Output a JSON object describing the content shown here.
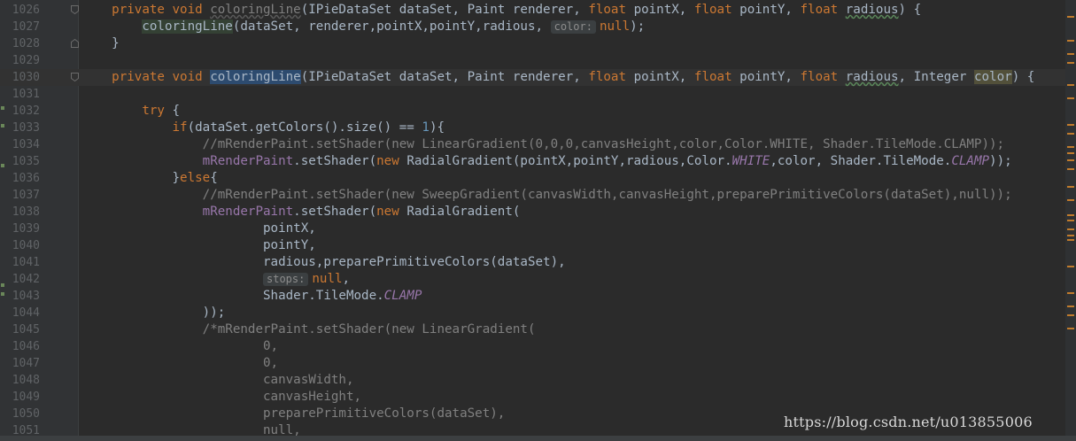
{
  "editor": {
    "watermark": "https://blog.csdn.net/u013855006",
    "lines": [
      {
        "num": "1026",
        "fold": "open",
        "segs": [
          [
            "    ",
            ""
          ],
          [
            "private void ",
            "kw"
          ],
          [
            "coloringLine",
            "unused"
          ],
          [
            "(IPieDataSet dataSet, Paint renderer, ",
            ""
          ],
          [
            "float ",
            "kw"
          ],
          [
            "pointX, ",
            ""
          ],
          [
            "float ",
            "kw"
          ],
          [
            "pointY, ",
            ""
          ],
          [
            "float ",
            "kw"
          ],
          [
            "radious",
            "typo"
          ],
          [
            ") {",
            ""
          ]
        ]
      },
      {
        "num": "1027",
        "segs": [
          [
            "        ",
            ""
          ],
          [
            "coloringLine",
            "hl"
          ],
          [
            "(dataSet, renderer,pointX,pointY,radious, ",
            ""
          ],
          [
            "color:",
            "hint"
          ],
          [
            "null",
            "kw"
          ],
          [
            ");",
            ""
          ]
        ]
      },
      {
        "num": "1028",
        "fold": "close",
        "segs": [
          [
            "    }",
            ""
          ]
        ]
      },
      {
        "num": "1029",
        "segs": []
      },
      {
        "num": "1030",
        "fold": "open",
        "current": true,
        "segs": [
          [
            "    ",
            ""
          ],
          [
            "private void ",
            "kw"
          ],
          [
            "coloringLine",
            "usage"
          ],
          [
            "(IPieDataSet dataSet, Paint renderer, ",
            ""
          ],
          [
            "float ",
            "kw"
          ],
          [
            "pointX, ",
            ""
          ],
          [
            "float ",
            "kw"
          ],
          [
            "pointY, ",
            ""
          ],
          [
            "float ",
            "kw"
          ],
          [
            "radious",
            "typo"
          ],
          [
            ", Integer ",
            ""
          ],
          [
            "color",
            "warn-param"
          ],
          [
            ") {",
            ""
          ]
        ]
      },
      {
        "num": "1031",
        "segs": []
      },
      {
        "num": "1032",
        "segs": [
          [
            "        ",
            ""
          ],
          [
            "try ",
            "kw"
          ],
          [
            "{",
            ""
          ]
        ]
      },
      {
        "num": "1033",
        "segs": [
          [
            "            ",
            ""
          ],
          [
            "if",
            "kw"
          ],
          [
            "(dataSet.getColors().size() == ",
            ""
          ],
          [
            "1",
            "num"
          ],
          [
            "){",
            ""
          ]
        ]
      },
      {
        "num": "1034",
        "segs": [
          [
            "                ",
            ""
          ],
          [
            "//mRenderPaint.setShader(new LinearGradient(0,0,0,canvasHeight,color,Color.WHITE, Shader.TileMode.CLAMP));",
            "cmt"
          ]
        ]
      },
      {
        "num": "1035",
        "segs": [
          [
            "                ",
            ""
          ],
          [
            "mRenderPaint",
            "field"
          ],
          [
            ".setShader(",
            ""
          ],
          [
            "new ",
            "kw"
          ],
          [
            "RadialGradient(pointX,pointY,radious,Color.",
            ""
          ],
          [
            "WHITE",
            "static"
          ],
          [
            ",color, Shader.TileMode.",
            ""
          ],
          [
            "CLAMP",
            "static"
          ],
          [
            "));",
            ""
          ]
        ]
      },
      {
        "num": "1036",
        "segs": [
          [
            "            }",
            ""
          ],
          [
            "else",
            "kw"
          ],
          [
            "{",
            ""
          ]
        ]
      },
      {
        "num": "1037",
        "segs": [
          [
            "                ",
            ""
          ],
          [
            "//mRenderPaint.setShader(new SweepGradient(canvasWidth,canvasHeight,preparePrimitiveColors(dataSet),null));",
            "cmt"
          ]
        ]
      },
      {
        "num": "1038",
        "segs": [
          [
            "                ",
            ""
          ],
          [
            "mRenderPaint",
            "field"
          ],
          [
            ".setShader(",
            ""
          ],
          [
            "new ",
            "kw"
          ],
          [
            "RadialGradient(",
            ""
          ]
        ]
      },
      {
        "num": "1039",
        "segs": [
          [
            "                        pointX,",
            ""
          ]
        ]
      },
      {
        "num": "1040",
        "segs": [
          [
            "                        pointY,",
            ""
          ]
        ]
      },
      {
        "num": "1041",
        "segs": [
          [
            "                        radious,preparePrimitiveColors(dataSet),",
            ""
          ]
        ]
      },
      {
        "num": "1042",
        "segs": [
          [
            "                        ",
            ""
          ],
          [
            "stops:",
            "hint"
          ],
          [
            "null",
            "kw"
          ],
          [
            ",",
            ""
          ]
        ]
      },
      {
        "num": "1043",
        "segs": [
          [
            "                        Shader.TileMode.",
            ""
          ],
          [
            "CLAMP",
            "static"
          ]
        ]
      },
      {
        "num": "1044",
        "segs": [
          [
            "                ));",
            ""
          ]
        ]
      },
      {
        "num": "1045",
        "segs": [
          [
            "                ",
            ""
          ],
          [
            "/*mRenderPaint.setShader(new LinearGradient(",
            "cmt"
          ]
        ]
      },
      {
        "num": "1046",
        "segs": [
          [
            "                        0,",
            "cmt"
          ]
        ]
      },
      {
        "num": "1047",
        "segs": [
          [
            "                        0,",
            "cmt"
          ]
        ]
      },
      {
        "num": "1048",
        "segs": [
          [
            "                        canvasWidth,",
            "cmt"
          ]
        ]
      },
      {
        "num": "1049",
        "segs": [
          [
            "                        canvasHeight,",
            "cmt"
          ]
        ]
      },
      {
        "num": "1050",
        "segs": [
          [
            "                        preparePrimitiveColors(dataSet),",
            "cmt"
          ]
        ]
      },
      {
        "num": "1051",
        "segs": [
          [
            "                        null,",
            "cmt"
          ]
        ]
      }
    ],
    "scroll_marks": [
      {
        "color": "#c07b2c"
      },
      {
        "color": "#c07b2c"
      },
      {
        "color": "#c07b2c"
      },
      {
        "color": "#c07b2c"
      },
      {
        "color": "#c07b2c"
      },
      {
        "color": "#c07b2c"
      },
      {
        "color": "#c07b2c"
      },
      {
        "color": "#c07b2c"
      },
      {
        "color": "#c07b2c"
      },
      {
        "color": "#c07b2c"
      },
      {
        "color": "#c07b2c"
      },
      {
        "color": "#c07b2c"
      },
      {
        "color": "#c07b2c"
      },
      {
        "color": "#c07b2c"
      },
      {
        "color": "#c07b2c"
      },
      {
        "color": "#c07b2c"
      },
      {
        "color": "#c07b2c"
      },
      {
        "color": "#c07b2c"
      },
      {
        "color": "#c07b2c"
      },
      {
        "color": "#c07b2c"
      },
      {
        "color": "#c07b2c"
      },
      {
        "color": "#c07b2c"
      },
      {
        "color": "#c07b2c"
      },
      {
        "color": "#c07b2c"
      }
    ]
  }
}
